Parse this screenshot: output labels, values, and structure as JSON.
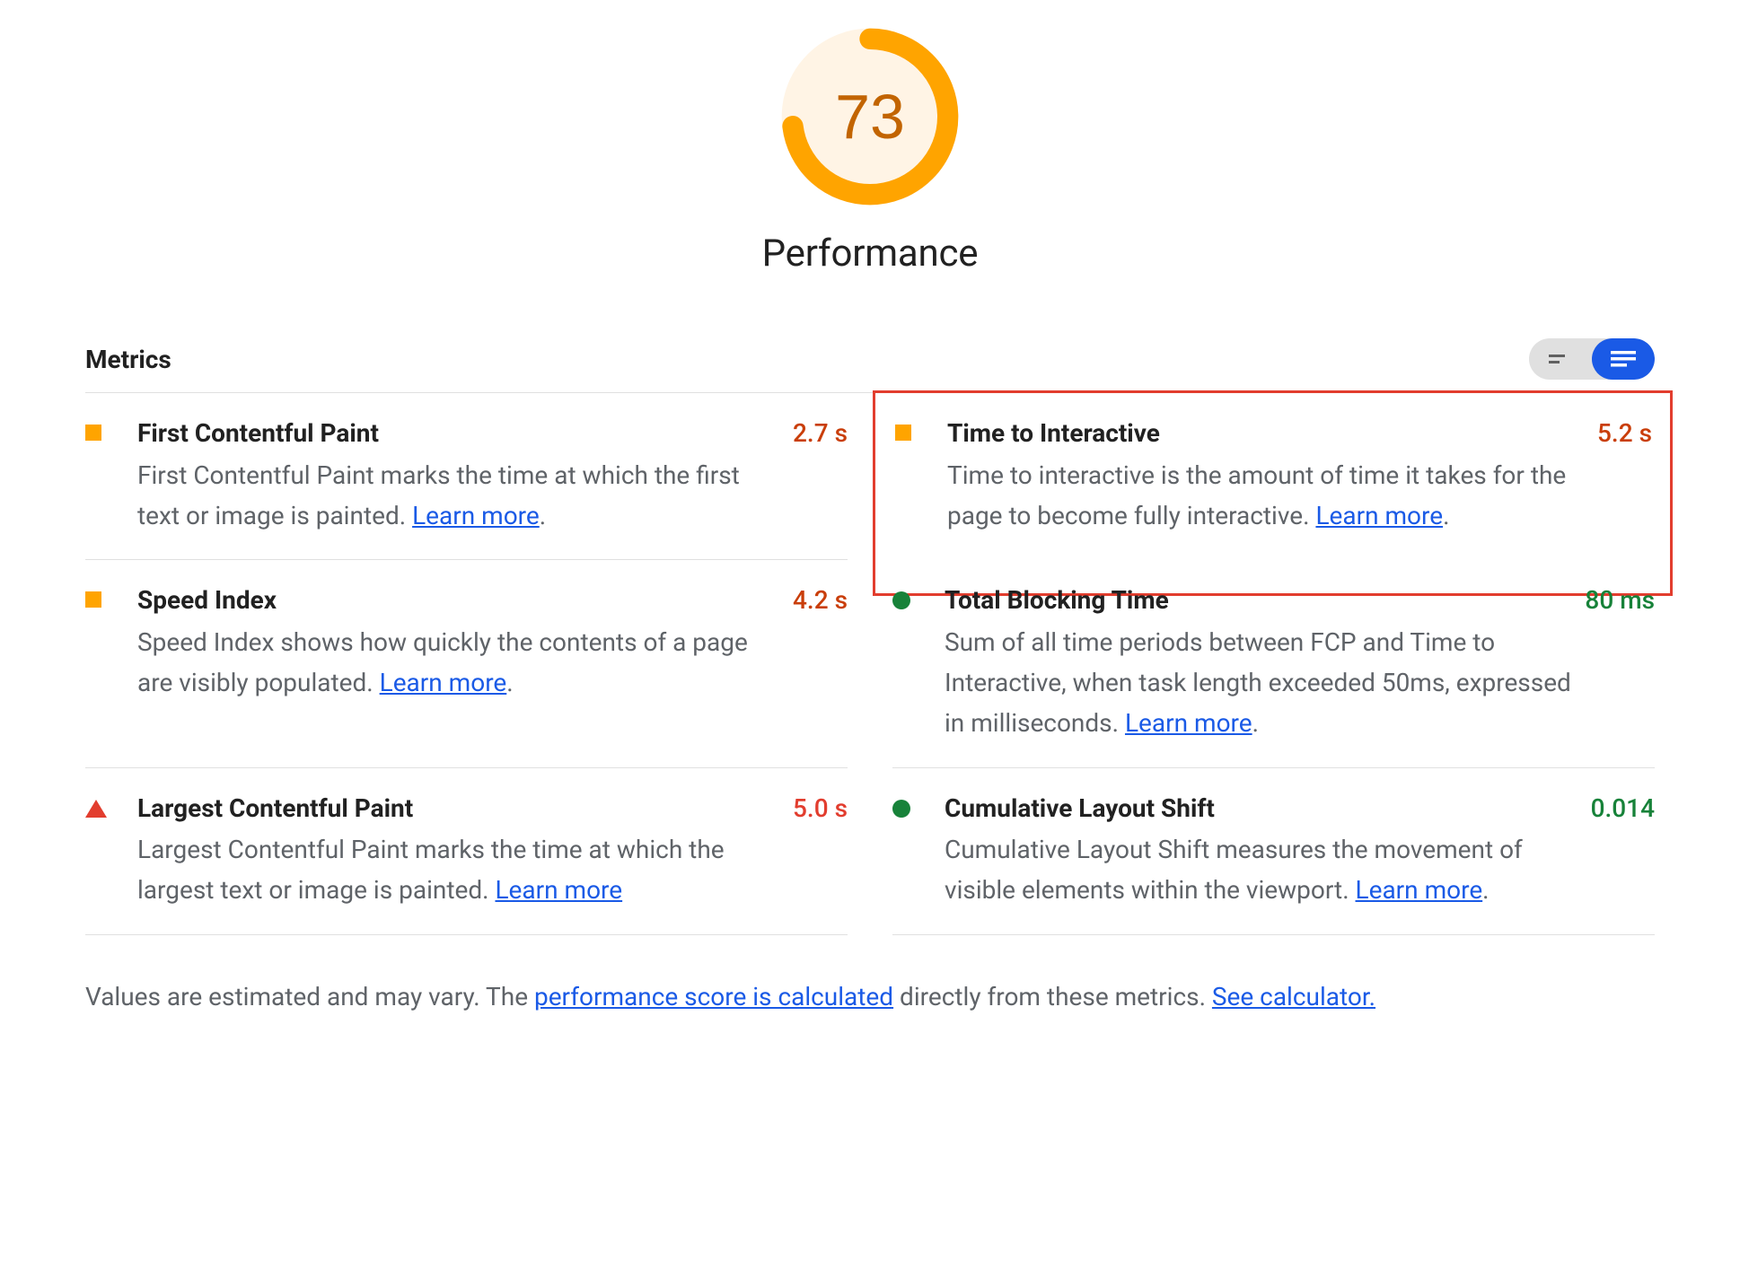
{
  "gauge": {
    "score": "73",
    "scoreNum": 73,
    "category": "Performance"
  },
  "metricsHeader": "Metrics",
  "learnMore": "Learn more",
  "metrics": [
    {
      "id": "fcp",
      "title": "First Contentful Paint",
      "desc": "First Contentful Paint marks the time at which the first text or image is painted. ",
      "value": "2.7 s",
      "status": "average",
      "valueColor": "orange",
      "trailingPeriod": "."
    },
    {
      "id": "tti",
      "title": "Time to Interactive",
      "desc": "Time to interactive is the amount of time it takes for the page to become fully interactive. ",
      "value": "5.2 s",
      "status": "average",
      "valueColor": "orange",
      "highlighted": true,
      "trailingPeriod": "."
    },
    {
      "id": "si",
      "title": "Speed Index",
      "desc": "Speed Index shows how quickly the contents of a page are visibly populated. ",
      "value": "4.2 s",
      "status": "average",
      "valueColor": "orange",
      "trailingPeriod": "."
    },
    {
      "id": "tbt",
      "title": "Total Blocking Time",
      "desc": "Sum of all time periods between FCP and Time to Interactive, when task length exceeded 50ms, expressed in milliseconds. ",
      "value": "80 ms",
      "status": "pass",
      "valueColor": "green",
      "trailingPeriod": "."
    },
    {
      "id": "lcp",
      "title": "Largest Contentful Paint",
      "desc": "Largest Contentful Paint marks the time at which the largest text or image is painted. ",
      "value": "5.0 s",
      "status": "fail",
      "valueColor": "red",
      "trailingPeriod": ""
    },
    {
      "id": "cls",
      "title": "Cumulative Layout Shift",
      "desc": "Cumulative Layout Shift measures the movement of visible elements within the viewport. ",
      "value": "0.014",
      "status": "pass",
      "valueColor": "green",
      "trailingPeriod": "."
    }
  ],
  "footnote": {
    "prefix": "Values are estimated and may vary. The ",
    "link1": "performance score is calculated",
    "middle": " directly from these metrics. ",
    "link2": "See calculator."
  }
}
